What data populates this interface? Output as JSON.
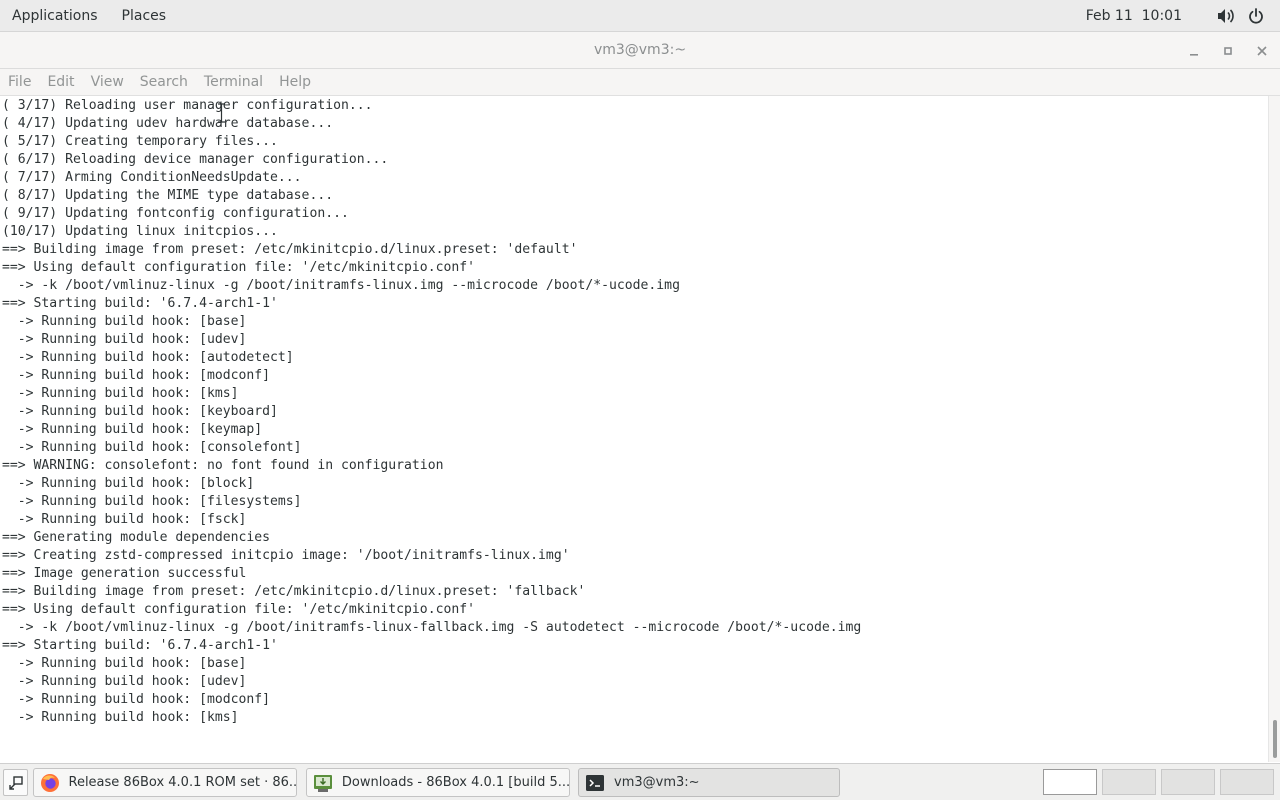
{
  "top_panel": {
    "menus": [
      "Applications",
      "Places"
    ],
    "clock": "Feb 11  10:01",
    "icons": [
      "volume-icon",
      "power-icon"
    ]
  },
  "window": {
    "title": "vm3@vm3:~",
    "buttons": [
      "minimize",
      "maximize",
      "close"
    ]
  },
  "menubar": {
    "items": [
      "File",
      "Edit",
      "View",
      "Search",
      "Terminal",
      "Help"
    ]
  },
  "terminal": {
    "lines": [
      "( 3/17) Reloading user manager configuration...",
      "( 4/17) Updating udev hardware database...",
      "( 5/17) Creating temporary files...",
      "( 6/17) Reloading device manager configuration...",
      "( 7/17) Arming ConditionNeedsUpdate...",
      "( 8/17) Updating the MIME type database...",
      "( 9/17) Updating fontconfig configuration...",
      "(10/17) Updating linux initcpios...",
      "==> Building image from preset: /etc/mkinitcpio.d/linux.preset: 'default'",
      "==> Using default configuration file: '/etc/mkinitcpio.conf'",
      "  -> -k /boot/vmlinuz-linux -g /boot/initramfs-linux.img --microcode /boot/*-ucode.img",
      "==> Starting build: '6.7.4-arch1-1'",
      "  -> Running build hook: [base]",
      "  -> Running build hook: [udev]",
      "  -> Running build hook: [autodetect]",
      "  -> Running build hook: [modconf]",
      "  -> Running build hook: [kms]",
      "  -> Running build hook: [keyboard]",
      "  -> Running build hook: [keymap]",
      "  -> Running build hook: [consolefont]",
      "==> WARNING: consolefont: no font found in configuration",
      "  -> Running build hook: [block]",
      "  -> Running build hook: [filesystems]",
      "  -> Running build hook: [fsck]",
      "==> Generating module dependencies",
      "==> Creating zstd-compressed initcpio image: '/boot/initramfs-linux.img'",
      "==> Image generation successful",
      "==> Building image from preset: /etc/mkinitcpio.d/linux.preset: 'fallback'",
      "==> Using default configuration file: '/etc/mkinitcpio.conf'",
      "  -> -k /boot/vmlinuz-linux -g /boot/initramfs-linux-fallback.img -S autodetect --microcode /boot/*-ucode.img",
      "==> Starting build: '6.7.4-arch1-1'",
      "  -> Running build hook: [base]",
      "  -> Running build hook: [udev]",
      "  -> Running build hook: [modconf]",
      "  -> Running build hook: [kms]"
    ]
  },
  "taskbar": {
    "tasks": [
      {
        "label": "Release 86Box 4.0.1 ROM set · 86...",
        "icon": "firefox-icon",
        "active": false
      },
      {
        "label": "Downloads - 86Box 4.0.1 [build 5...",
        "icon": "downloads-app-icon",
        "active": false
      },
      {
        "label": "vm3@vm3:~",
        "icon": "terminal-icon",
        "active": true
      }
    ],
    "workspaces": 4,
    "current_workspace": 1
  },
  "colors": {
    "panel_bg": "#ebebeb",
    "titlebar_bg": "#f6f5f4",
    "terminal_bg": "#ffffff",
    "terminal_fg": "#2e3436",
    "dim_text": "#8b8e8f"
  }
}
